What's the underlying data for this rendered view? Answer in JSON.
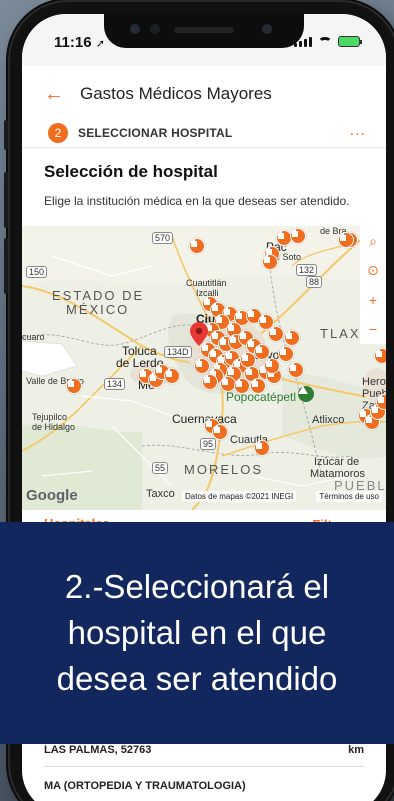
{
  "status": {
    "time": "11:16",
    "location_icon": "location-arrow-icon"
  },
  "header": {
    "title": "Gastos Médicos Mayores"
  },
  "step": {
    "number": "2",
    "label": "SELECCIONAR HOSPITAL",
    "more": "..."
  },
  "section": {
    "title": "Selección de hospital",
    "subtitle": "Elige la institución médica en la que deseas ser atendido."
  },
  "map": {
    "labels": {
      "estado1": "ESTADO DE",
      "estado2": "MÉXICO",
      "toluca1": "Toluca",
      "toluca2": "de Lerdo",
      "cuautitlan1": "Cuautitlán",
      "cuautitlan2": "Izcalli",
      "pachuca1": "Pac",
      "pachuca2": "de Soto",
      "ciudad": "Ciu",
      "coyotl": "cóyotl",
      "tlaxcala": "TLAXC",
      "popocatepetl": "Popocatépetl",
      "cuernavaca": "Cuernavaca",
      "cuautla": "Cuautla",
      "atlixco": "Atlixco",
      "morelos": "MORELOS",
      "izucar1": "Izúcar de",
      "izucar2": "Matamoros",
      "heroica1": "Heroic",
      "heroica2": "Puebla",
      "heroica3": "Zarago",
      "valle": "Valle de Bravo",
      "tejupilco1": "Tejupilco",
      "tejupilco2": "de Hidalgo",
      "taxco": "Taxco",
      "cuaro": "cuaro",
      "debra": "de Bra",
      "puebla_state": "PUEBL",
      "me": "Me",
      "r570": "570",
      "r150": "150",
      "r132": "132",
      "r88": "88",
      "r134d": "134D",
      "r134": "134",
      "r55": "55",
      "r95": "95"
    },
    "google": "Google",
    "attribution": "Datos de mapas ©2021 INEGI",
    "terms": "Términos de uso",
    "controls": [
      "search-icon",
      "locate-icon",
      "zoom-in-icon",
      "zoom-out-icon"
    ]
  },
  "filters": {
    "left": "Hospitales ⌄",
    "right": "Filtros ›"
  },
  "overlay": {
    "line1": "2.-Seleccionará el",
    "line2": "hospital en el que",
    "line3": "desea ser atendido"
  },
  "list": {
    "row1_name": "LAS PALMAS, 52763",
    "row1_dist": "km",
    "row2_name": "MA (ORTOPEDIA Y TRAUMATOLOGIA)"
  },
  "colors": {
    "accent": "#f06d1f",
    "overlay": "#11275e",
    "map_bg": "#eef0e6"
  }
}
